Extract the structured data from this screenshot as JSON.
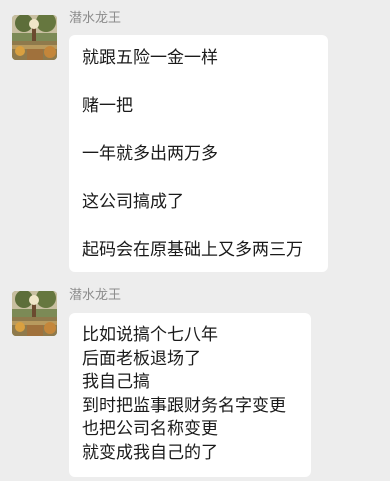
{
  "messages": [
    {
      "sender": "潜水龙王",
      "avatar_icon": "landscape-avatar-icon",
      "lines": [
        "就跟五险一金一样",
        "",
        "赌一把",
        "",
        "一年就多出两万多",
        "",
        "这公司搞成了",
        "",
        "起码会在原基础上又多两三万"
      ]
    },
    {
      "sender": "潜水龙王",
      "avatar_icon": "landscape-avatar-icon",
      "lines": [
        "比如说搞个七八年",
        "后面老板退场了",
        "我自己搞",
        "到时把监事跟财务名字变更",
        "也把公司名称变更",
        "就变成我自己的了"
      ]
    }
  ],
  "colors": {
    "background": "#ededed",
    "bubble": "#ffffff",
    "sender_name": "#8c8c8c",
    "message_text": "#1a1a1a"
  }
}
